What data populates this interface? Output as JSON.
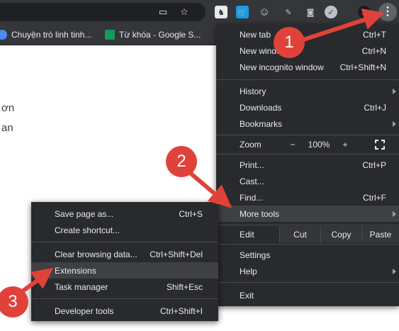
{
  "toolbar": {
    "icons": [
      "display-icon",
      "star-icon"
    ],
    "extensions": [
      "puzzle-ext-icon",
      "shopping-ext-icon",
      "emoji-ext-icon",
      "pen-ext-icon",
      "camera-ext-icon",
      "check-ext-icon",
      "avatar-ext-icon"
    ]
  },
  "bookmarks": {
    "item1": "Chuyện trò linh tinh...",
    "item2": "Từ khóa - Google S..."
  },
  "page": {
    "line1": "ơn",
    "line2": "an"
  },
  "main_menu": {
    "new_tab": "New tab",
    "new_tab_short": "Ctrl+T",
    "new_window": "New window",
    "new_window_short": "Ctrl+N",
    "new_incognito": "New incognito window",
    "new_incognito_short": "Ctrl+Shift+N",
    "history": "History",
    "downloads": "Downloads",
    "downloads_short": "Ctrl+J",
    "bookmarks": "Bookmarks",
    "zoom": "Zoom",
    "zoom_minus": "−",
    "zoom_value": "100%",
    "zoom_plus": "+",
    "print": "Print...",
    "print_short": "Ctrl+P",
    "cast": "Cast...",
    "find": "Find...",
    "find_short": "Ctrl+F",
    "more_tools": "More tools",
    "edit": "Edit",
    "cut": "Cut",
    "copy": "Copy",
    "paste": "Paste",
    "settings": "Settings",
    "help": "Help",
    "exit": "Exit"
  },
  "sub_menu": {
    "save_page": "Save page as...",
    "save_page_short": "Ctrl+S",
    "create_shortcut": "Create shortcut...",
    "clear_browsing": "Clear browsing data...",
    "clear_browsing_short": "Ctrl+Shift+Del",
    "extensions": "Extensions",
    "task_manager": "Task manager",
    "task_manager_short": "Shift+Esc",
    "developer_tools": "Developer tools",
    "developer_tools_short": "Ctrl+Shift+I"
  },
  "annotations": {
    "step1": "1",
    "step2": "2",
    "step3": "3"
  },
  "colors": {
    "accent_red": "#e0423a",
    "menu_bg": "#292a2d",
    "highlight": "#3f4042"
  }
}
